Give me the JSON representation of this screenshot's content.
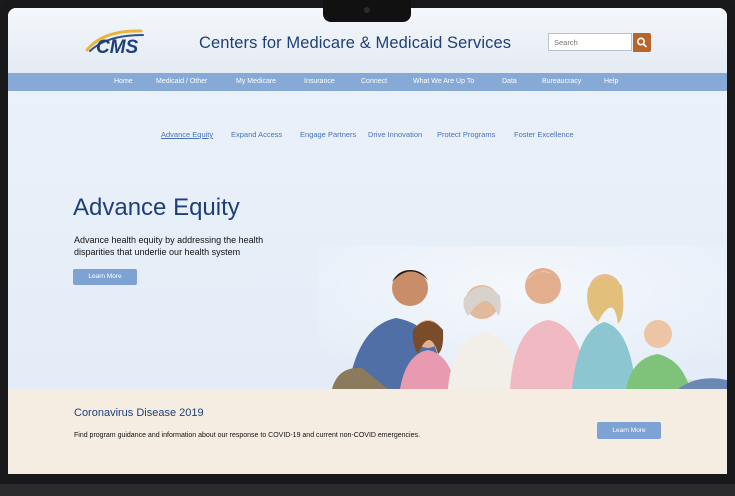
{
  "header": {
    "logo_text": "CMS",
    "site_title": "Centers for Medicare & Medicaid Services",
    "search_placeholder": "Search"
  },
  "nav": {
    "items": [
      {
        "label": "Home"
      },
      {
        "label": "Medicaid / Other"
      },
      {
        "label": "My Medicare"
      },
      {
        "label": "Insurance"
      },
      {
        "label": "Connect"
      },
      {
        "label": "What We Are Up To"
      },
      {
        "label": "Data"
      },
      {
        "label": "Bureaucracy"
      },
      {
        "label": "Help"
      }
    ]
  },
  "subnav": {
    "items": [
      {
        "label": "Advance Equity",
        "active": true
      },
      {
        "label": "Expand Access"
      },
      {
        "label": "Engage Partners"
      },
      {
        "label": "Drive Innovation"
      },
      {
        "label": "Protect Programs"
      },
      {
        "label": "Foster Excellence"
      }
    ]
  },
  "hero": {
    "title": "Advance Equity",
    "description": "Advance health equity by addressing the health disparities that underlie our health system",
    "button_label": "Learn More"
  },
  "covid": {
    "title": "Coronavirus Disease 2019",
    "description": "Find program guidance and information about our response to COVID-19 and current non-COVID emergencies.",
    "button_label": "Learn More"
  },
  "colors": {
    "brand_blue": "#1f3f7a",
    "nav_blue": "#86a9d5",
    "button_blue": "#7ea2d4",
    "search_orange": "#b7652a",
    "covid_bg": "#f5ede1"
  }
}
